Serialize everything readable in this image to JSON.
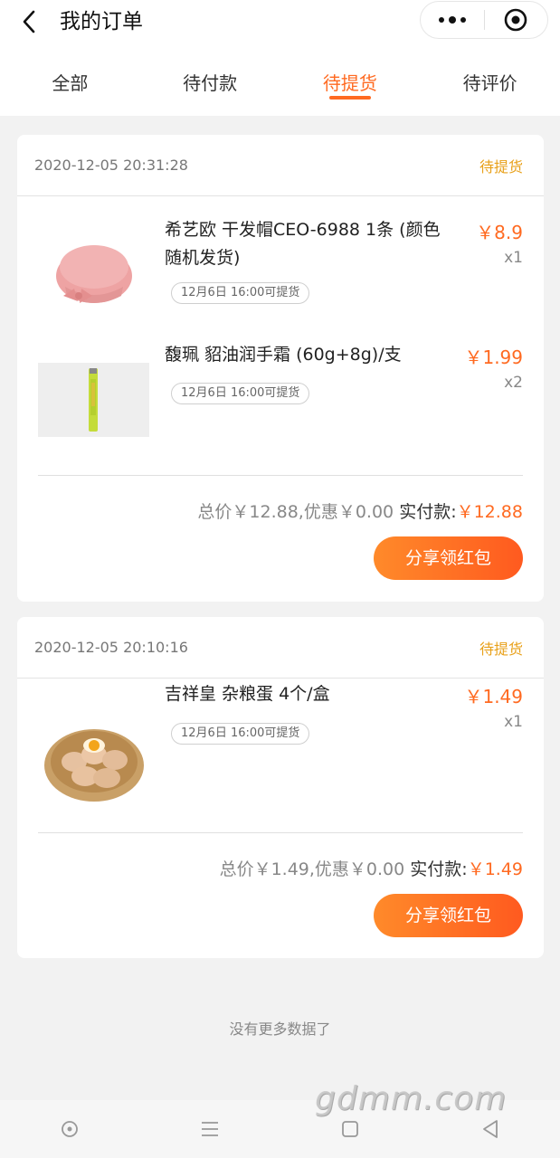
{
  "header": {
    "title": "我的订单",
    "back_icon": "back-arrow-icon",
    "more_icon": "more-dots-icon",
    "close_icon": "target-close-icon"
  },
  "tabs": [
    {
      "label": "全部",
      "active": false
    },
    {
      "label": "待付款",
      "active": false
    },
    {
      "label": "待提货",
      "active": true
    },
    {
      "label": "待评价",
      "active": false
    }
  ],
  "orders": [
    {
      "time": "2020-12-05 20:31:28",
      "status": "待提货",
      "items": [
        {
          "name": "希艺欧 干发帽CEO-6988 1条 (颜色随机发货)",
          "pickup": "12月6日 16:00可提货",
          "price": "￥8.9",
          "qty": "x1",
          "image": "pink-hair-cap"
        },
        {
          "name": "馥珮 貂油润手霜 (60g+8g)/支",
          "pickup": "12月6日 16:00可提货",
          "price": "￥1.99",
          "qty": "x2",
          "image": "yellow-hand-cream-tube"
        }
      ],
      "summary": {
        "total": "总价￥12.88,优惠￥0.00",
        "paid_label": "实付款:",
        "paid": "￥12.88"
      },
      "share_label": "分享领红包"
    },
    {
      "time": "2020-12-05 20:10:16",
      "status": "待提货",
      "items": [
        {
          "name": "吉祥皇 杂粮蛋 4个/盒",
          "pickup": "12月6日 16:00可提货",
          "price": "￥1.49",
          "qty": "x1",
          "image": "eggs-in-basket"
        }
      ],
      "summary": {
        "total": "总价￥1.49,优惠￥0.00",
        "paid_label": "实付款:",
        "paid": "￥1.49"
      },
      "share_label": "分享领红包"
    }
  ],
  "footer": {
    "no_more": "没有更多数据了"
  },
  "watermark": "gdmm.com",
  "colors": {
    "accent": "#ff6a21",
    "status": "#e8a019"
  }
}
